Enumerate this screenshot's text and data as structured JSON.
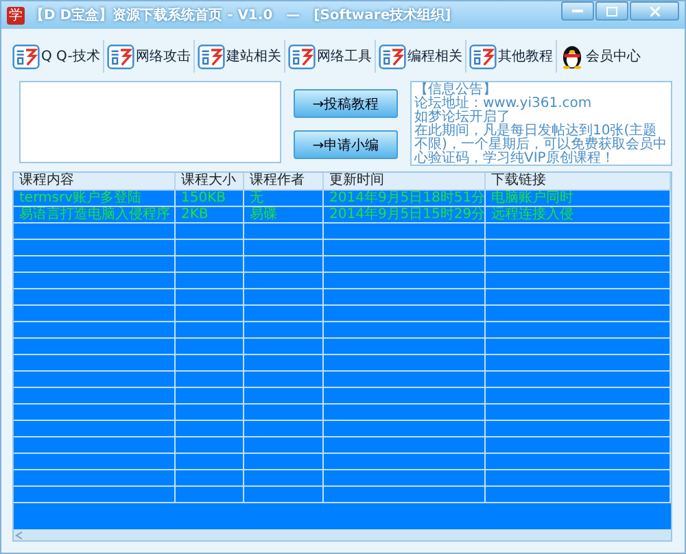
{
  "window": {
    "app_icon": "学",
    "title": "【D D宝盒】资源下载系统首页 - V1.0　—　[Software技术组织]"
  },
  "toolbar": [
    {
      "label": "Q Q-技术",
      "kind": "tile"
    },
    {
      "label": "网络攻击",
      "kind": "tile"
    },
    {
      "label": "建站相关",
      "kind": "tile"
    },
    {
      "label": "网络工具",
      "kind": "tile"
    },
    {
      "label": "编程相关",
      "kind": "tile"
    },
    {
      "label": "其他教程",
      "kind": "tile"
    },
    {
      "label": "会员中心",
      "kind": "penguin"
    }
  ],
  "actions": [
    "→投稿教程",
    "→申请小编"
  ],
  "notice": [
    "【信息公告】",
    "论坛地址：www.yi361.com",
    "如梦论坛开启了",
    "在此期间，凡是每日发帖达到10张(主题不限)，一个星期后，可以免费获取会员中心验证码，学习纯VIP原创课程！"
  ],
  "table": {
    "columns": [
      "课程内容",
      "课程大小",
      "课程作者",
      "更新时间",
      "下载链接"
    ],
    "rows": [
      [
        "termsrv账户多登陆",
        "150KB",
        "无",
        "2014年9月5日18时51分",
        "电脑账户同时"
      ],
      [
        "易语言打造电脑入侵程序",
        "2KB",
        "易碟",
        "2014年9月5日15时29分",
        "远程连接入侵"
      ]
    ]
  }
}
